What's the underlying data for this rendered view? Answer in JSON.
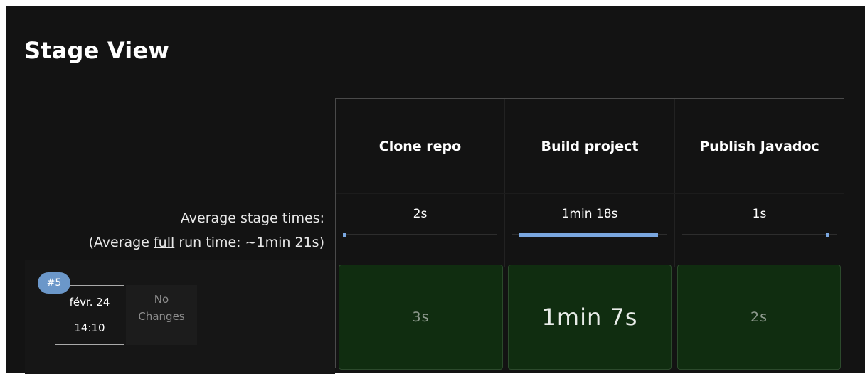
{
  "page": {
    "title": "Stage View"
  },
  "stages": [
    {
      "name": "Clone repo",
      "average": "2s",
      "avg_fraction": 0.025
    },
    {
      "name": "Build project",
      "average": "1min 18s",
      "avg_fraction": 1.0
    },
    {
      "name": "Publish Javadoc",
      "average": "1s",
      "avg_fraction": 0.013
    }
  ],
  "average_label": {
    "line1": "Average stage times:",
    "line2_prefix": "(Average ",
    "line2_underlined": "full",
    "line2_suffix": " run time: ~1min 21s)"
  },
  "run": {
    "badge": "#5",
    "date": "févr. 24",
    "time": "14:10",
    "changes_line1": "No",
    "changes_line2": "Changes",
    "stage_times": [
      "3s",
      "1min 7s",
      "2s"
    ]
  },
  "colors": {
    "panel_bg": "#131313",
    "success_cell": "#102d10",
    "bar": "#7aa7e0",
    "badge": "#6b97c9"
  }
}
